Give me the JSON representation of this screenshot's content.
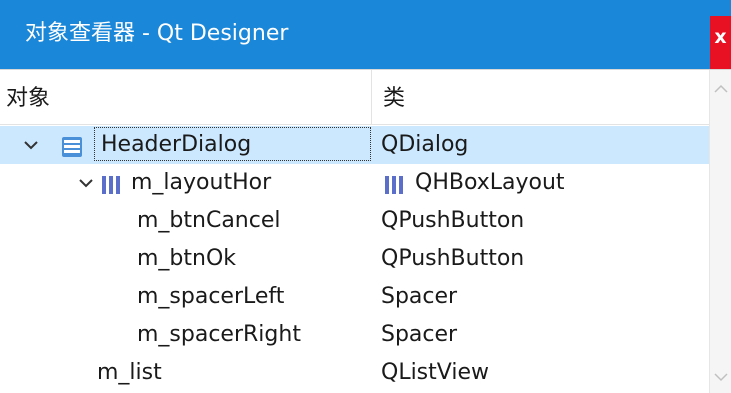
{
  "window": {
    "title": "对象查看器 - Qt Designer",
    "close_label": "x"
  },
  "header": {
    "col_name": "对象",
    "col_class": "类"
  },
  "rows": [
    {
      "name": "HeaderDialog",
      "class": "QDialog"
    },
    {
      "name": "m_layoutHor",
      "class": "QHBoxLayout"
    },
    {
      "name": "m_btnCancel",
      "class": "QPushButton"
    },
    {
      "name": "m_btnOk",
      "class": "QPushButton"
    },
    {
      "name": "m_spacerLeft",
      "class": "Spacer"
    },
    {
      "name": "m_spacerRight",
      "class": "Spacer"
    },
    {
      "name": "m_list",
      "class": "QListView"
    }
  ],
  "selected_row": "HeaderDialog",
  "icons": {
    "dialog": "form-icon",
    "layout": "hbox-layout-icon"
  },
  "colors": {
    "titlebar": "#1a87d8",
    "selection": "#cce8ff",
    "close": "#e81123"
  }
}
